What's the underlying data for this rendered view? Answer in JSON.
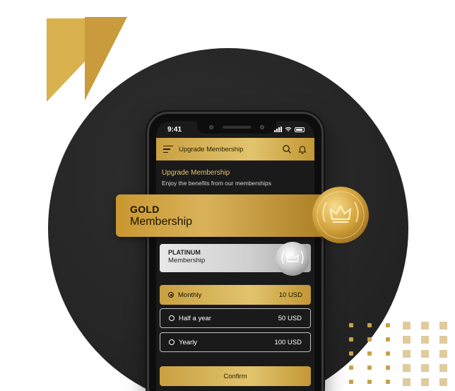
{
  "status": {
    "time": "9:41"
  },
  "appbar": {
    "title": "Upgrade Membership",
    "menu_icon": "menu-icon",
    "search_icon": "search-icon",
    "bell_icon": "bell-icon"
  },
  "header": {
    "title": "Upgrade Membership",
    "subtitle": "Enjoy the benefits from our memberships"
  },
  "gold": {
    "tier": "GOLD",
    "label": "Membership",
    "icon": "crown-medal-icon"
  },
  "platinum": {
    "tier": "PLATINUM",
    "label": "Membership",
    "icon": "crown-medal-icon"
  },
  "options": [
    {
      "label": "Monthly",
      "price": "10 USD",
      "selected": true
    },
    {
      "label": "Half a year",
      "price": "50 USD",
      "selected": false
    },
    {
      "label": "Yearly",
      "price": "100 USD",
      "selected": false
    }
  ],
  "confirm_label": "Confirm",
  "colors": {
    "gold": "#d9b14f",
    "dark": "#262626",
    "silver": "#cfcfcf"
  }
}
